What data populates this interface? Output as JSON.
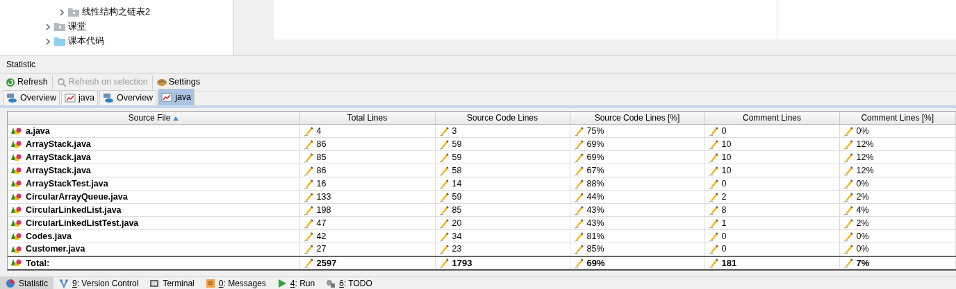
{
  "tree": [
    {
      "label": "线性结构之链表2",
      "kind": "package",
      "expanded": false
    },
    {
      "label": "课堂",
      "kind": "package",
      "expanded": false
    },
    {
      "label": "课本代码",
      "kind": "folder",
      "expanded": false
    }
  ],
  "panel": {
    "title": "Statistic"
  },
  "toolbar": [
    {
      "label": "Refresh",
      "kind": "refresh",
      "disabled": false
    },
    {
      "label": "Refresh on selection",
      "kind": "search",
      "disabled": true
    },
    {
      "label": "Settings",
      "kind": "palette",
      "disabled": false
    }
  ],
  "tabs": [
    {
      "label": "Overview",
      "kind": "overview",
      "selected": false
    },
    {
      "label": "java",
      "kind": "chart",
      "selected": false
    },
    {
      "label": "Overview",
      "kind": "overview",
      "selected": false
    },
    {
      "label": "java",
      "kind": "chart",
      "selected": true
    }
  ],
  "table": {
    "columns": [
      {
        "label": "Source File",
        "sorted": true
      },
      {
        "label": "Total Lines",
        "sorted": false
      },
      {
        "label": "Source Code Lines",
        "sorted": false
      },
      {
        "label": "Source Code Lines [%]",
        "sorted": false
      },
      {
        "label": "Comment Lines",
        "sorted": false
      },
      {
        "label": "Comment Lines [%]",
        "sorted": false
      }
    ],
    "rows": [
      [
        "a.java",
        "4",
        "3",
        "75%",
        "0",
        "0%"
      ],
      [
        "ArrayStack.java",
        "86",
        "59",
        "69%",
        "10",
        "12%"
      ],
      [
        "ArrayStack.java",
        "85",
        "59",
        "69%",
        "10",
        "12%"
      ],
      [
        "ArrayStack.java",
        "86",
        "58",
        "67%",
        "10",
        "12%"
      ],
      [
        "ArrayStackTest.java",
        "16",
        "14",
        "88%",
        "0",
        "0%"
      ],
      [
        "CircularArrayQueue.java",
        "133",
        "59",
        "44%",
        "2",
        "2%"
      ],
      [
        "CircularLinkedList.java",
        "198",
        "85",
        "43%",
        "8",
        "4%"
      ],
      [
        "CircularLinkedListTest.java",
        "47",
        "20",
        "43%",
        "1",
        "2%"
      ],
      [
        "Codes.java",
        "42",
        "34",
        "81%",
        "0",
        "0%"
      ],
      [
        "Customer.java",
        "27",
        "23",
        "85%",
        "0",
        "0%"
      ]
    ],
    "total": [
      "Total:",
      "2597",
      "1793",
      "69%",
      "181",
      "7%"
    ]
  },
  "status_bar": [
    {
      "label": "Statistic",
      "kind": "statistic",
      "selected": true
    },
    {
      "key": "9",
      "label": ": Version Control",
      "kind": "vcs",
      "selected": false
    },
    {
      "label": "Terminal",
      "kind": "terminal",
      "selected": false
    },
    {
      "key": "0",
      "label": ": Messages",
      "kind": "messages",
      "selected": false
    },
    {
      "key": "4",
      "label": ": Run",
      "kind": "run",
      "selected": false
    },
    {
      "key": "6",
      "label": ": TODO",
      "kind": "todo",
      "selected": false
    }
  ]
}
